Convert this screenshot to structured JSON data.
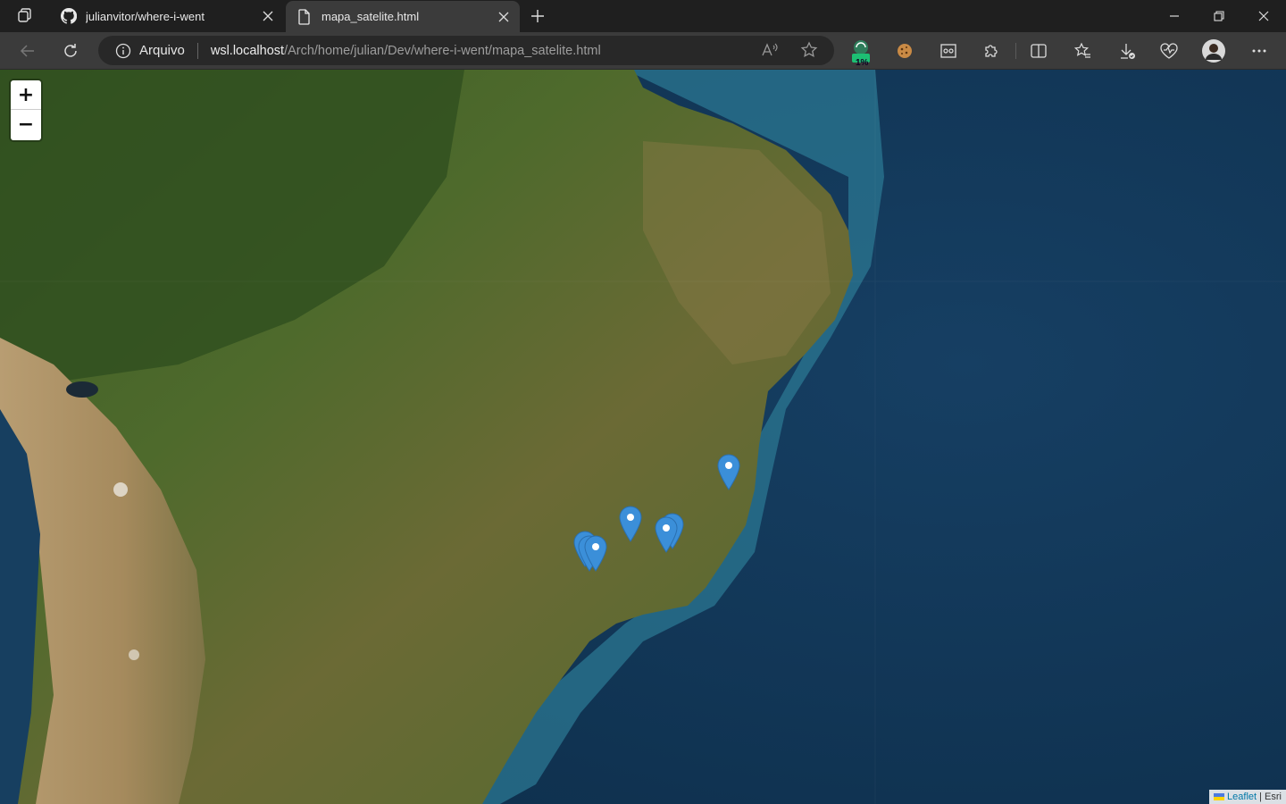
{
  "browser": {
    "tabs": [
      {
        "label": "julianvitor/where-i-went",
        "icon": "github-icon",
        "active": false
      },
      {
        "label": "mapa_satelite.html",
        "icon": "file-icon",
        "active": true
      }
    ],
    "address": {
      "site_info": "Arquivo",
      "url_host": "wsl.localhost",
      "url_path": "/Arch/home/julian/Dev/where-i-went/mapa_satelite.html"
    },
    "extension_badge": "1%"
  },
  "map": {
    "zoom_in": "+",
    "zoom_out": "−",
    "attribution": {
      "leaflet": "Leaflet",
      "separator": " | ",
      "provider": "Esri"
    },
    "marker_color": "#3b8fd9",
    "marker_count": 7
  }
}
